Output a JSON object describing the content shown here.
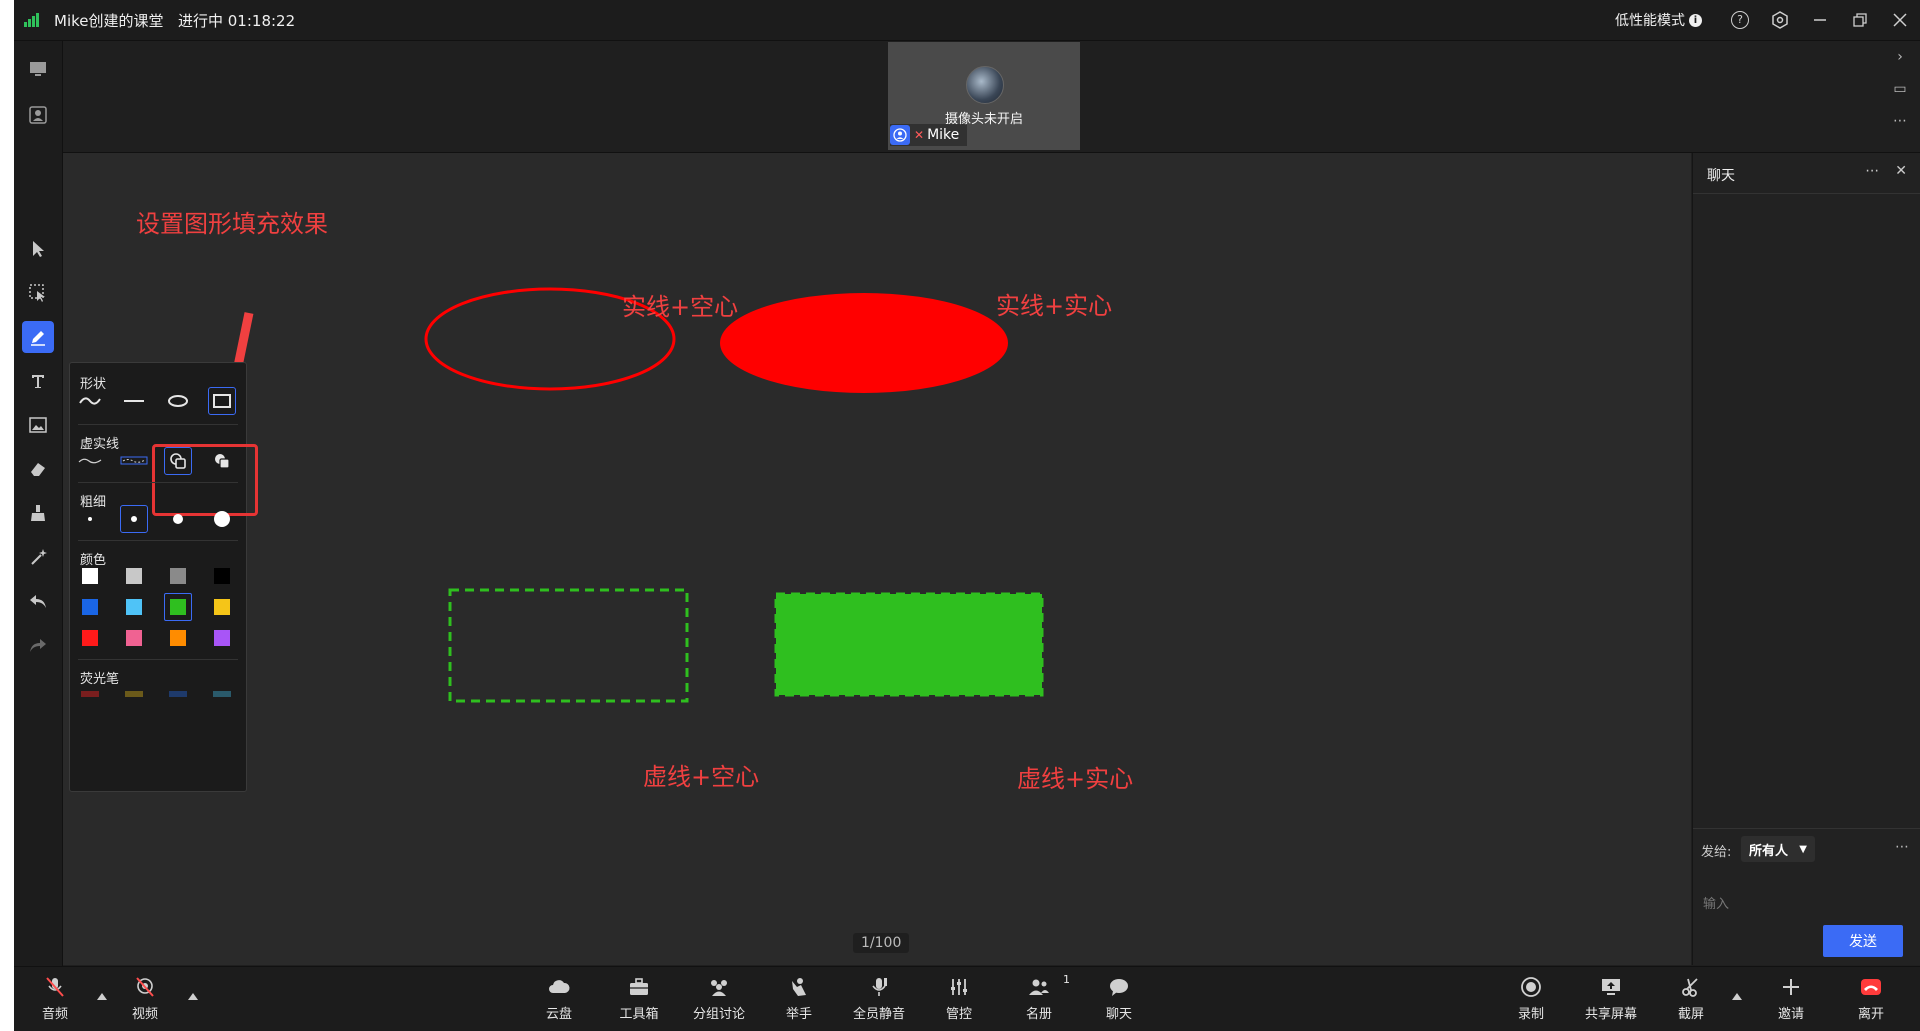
{
  "titlebar": {
    "title": "Mike创建的课堂",
    "status": "进行中 01:18:22",
    "low_perf": "低性能模式"
  },
  "video": {
    "camera_off": "摄像头未开启",
    "name": "Mike"
  },
  "board": {
    "annotation": "设置图形填充效果",
    "label_solid_hollow": "实线+空心",
    "label_solid_filled": "实线+实心",
    "label_dashed_hollow": "虚线+空心",
    "label_dashed_filled": "虚线+实心",
    "page": "1/100",
    "colors": {
      "red": "#ff0000",
      "green": "#2fbf1f",
      "annotation": "#f04040"
    }
  },
  "pen_panel": {
    "shape_label": "形状",
    "line_label": "虚实线",
    "thickness_label": "粗细",
    "color_label": "颜色",
    "highlighter_label": "荧光笔",
    "palette": [
      "#ffffff",
      "#c8c8c8",
      "#8a8a8a",
      "#000000",
      "#1a66e6",
      "#4fc3f7",
      "#2fbf1f",
      "#f5c518",
      "#ff1a1a",
      "#f06292",
      "#ff8c00",
      "#a855f7"
    ],
    "highlighters": [
      "#7a1e1e",
      "#6b5a1a",
      "#1e3a6b",
      "#2a5a6b"
    ],
    "selected_color": "#2fbf1f"
  },
  "chat": {
    "title": "聊天",
    "send_to_label": "发给:",
    "send_to_value": "所有人",
    "input_placeholder": "输入",
    "send_label": "发送"
  },
  "bottom": {
    "audio": "音频",
    "video": "视频",
    "cloud": "云盘",
    "toolbox": "工具箱",
    "breakout": "分组讨论",
    "raise_hand": "举手",
    "mute_all": "全员静音",
    "control": "管控",
    "roster": "名册",
    "roster_count": "1",
    "chat": "聊天",
    "record": "录制",
    "share": "共享屏幕",
    "screenshot": "截屏",
    "invite": "邀请",
    "leave": "离开"
  }
}
